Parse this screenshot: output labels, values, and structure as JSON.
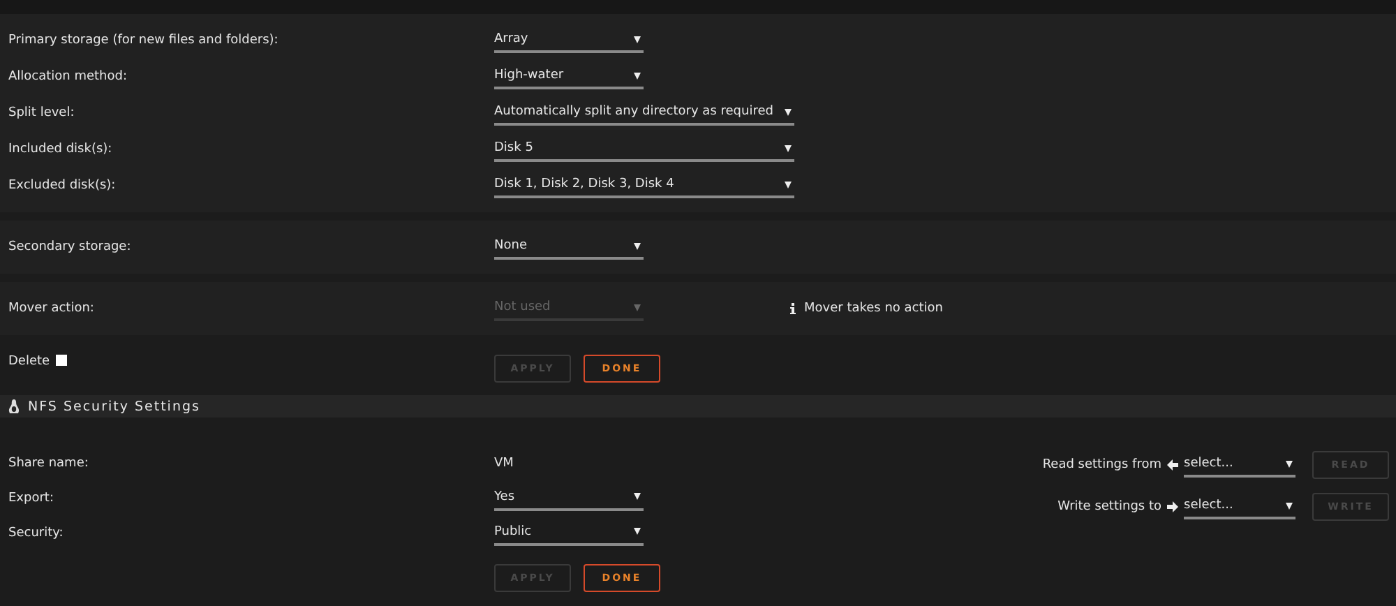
{
  "share_groups": [
    {
      "fields": [
        {
          "label": "Primary storage (for new files and folders):",
          "kind": "select",
          "value": "Array"
        },
        {
          "label": "Allocation method:",
          "kind": "select",
          "value": "High-water"
        },
        {
          "label": "Split level:",
          "kind": "wide_select",
          "value": "Automatically split any directory as required"
        },
        {
          "label": "Included disk(s):",
          "kind": "wide_select",
          "value": "Disk 5"
        },
        {
          "label": "Excluded disk(s):",
          "kind": "wide_select",
          "value": "Disk 1, Disk 2, Disk 3, Disk 4"
        }
      ]
    },
    {
      "fields": [
        {
          "label": "Secondary storage:",
          "kind": "select",
          "value": "None"
        }
      ]
    },
    {
      "fields": [
        {
          "label": "Mover action:",
          "kind": "select",
          "value": "Not used",
          "disabled": true,
          "info": "Mover takes no action"
        }
      ]
    }
  ],
  "delete": {
    "label": "Delete",
    "checked": false
  },
  "share_buttons": [
    {
      "label": "APPLY",
      "kind": "apply",
      "disabled": true
    },
    {
      "label": "DONE",
      "kind": "done"
    }
  ],
  "nfs_section": {
    "title": "NFS Security Settings",
    "fields": [
      {
        "label": "Share name:",
        "kind": "text",
        "value": "VM"
      },
      {
        "label": "Export:",
        "kind": "select",
        "value": "Yes"
      },
      {
        "label": "Security:",
        "kind": "select",
        "value": "Public"
      }
    ],
    "buttons": [
      {
        "label": "APPLY",
        "kind": "apply",
        "disabled": true
      },
      {
        "label": "DONE",
        "kind": "done"
      }
    ],
    "clone": [
      {
        "label": "Read settings from",
        "kind": "read",
        "placeholder": "select...",
        "button": "READ",
        "disabled": true
      },
      {
        "label": "Write settings to",
        "kind": "write",
        "placeholder": "select...",
        "button": "WRITE",
        "disabled": true
      }
    ]
  }
}
